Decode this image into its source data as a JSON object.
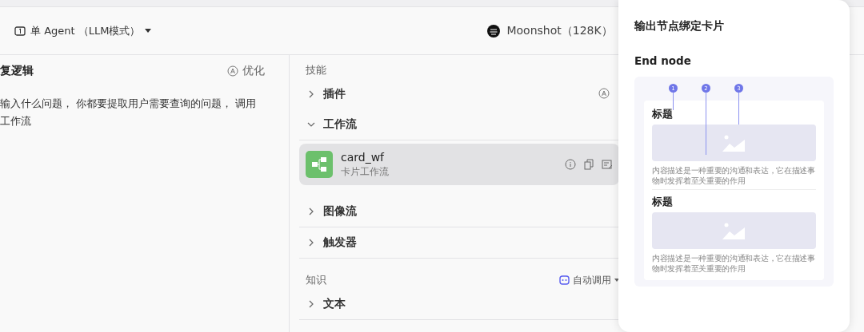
{
  "header": {
    "agent_mode": "单 Agent （LLM模式）",
    "model": "Moonshot（128K）"
  },
  "prompt_panel": {
    "title": "复逻辑",
    "optimize": "优化",
    "lines": [
      "输入什么问题， 你都要提取用户需要查询的问题， 调用",
      "工作流"
    ]
  },
  "skills": {
    "title": "技能",
    "items": [
      {
        "label": "插件",
        "expanded": false,
        "auto": true
      },
      {
        "label": "工作流",
        "expanded": true,
        "auto": false,
        "children": [
          {
            "name": "card_wf",
            "description": "卡片工作流",
            "selected": true
          }
        ]
      },
      {
        "label": "图像流",
        "expanded": false,
        "auto": false
      },
      {
        "label": "触发器",
        "expanded": false,
        "auto": false
      }
    ]
  },
  "knowledge": {
    "title": "知识",
    "mode": "自动调用",
    "items": [
      {
        "label": "文本",
        "expanded": false
      }
    ]
  },
  "popover": {
    "title": "输出节点绑定卡片",
    "subtitle": "End node",
    "markers": [
      "1",
      "2",
      "3"
    ],
    "cards": [
      {
        "title": "标题",
        "description": "内容描述是一种重要的沟通和表达，它在描述事物时发挥着至关重要的作用"
      },
      {
        "title": "标题",
        "description": "内容描述是一种重要的沟通和表达，它在描述事物时发挥着至关重要的作用"
      }
    ]
  }
}
